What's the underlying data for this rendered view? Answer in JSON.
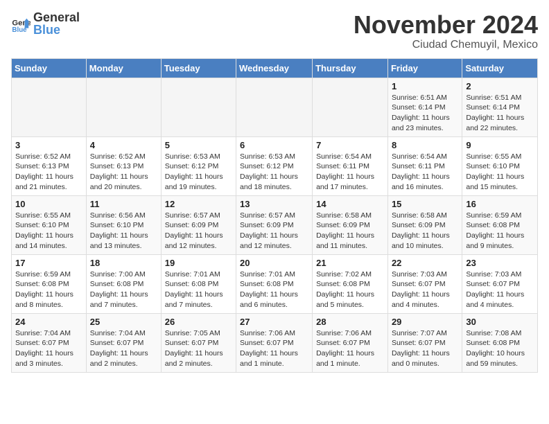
{
  "header": {
    "logo_general": "General",
    "logo_blue": "Blue",
    "month": "November 2024",
    "location": "Ciudad Chemuyil, Mexico"
  },
  "weekdays": [
    "Sunday",
    "Monday",
    "Tuesday",
    "Wednesday",
    "Thursday",
    "Friday",
    "Saturday"
  ],
  "weeks": [
    [
      {
        "day": "",
        "detail": ""
      },
      {
        "day": "",
        "detail": ""
      },
      {
        "day": "",
        "detail": ""
      },
      {
        "day": "",
        "detail": ""
      },
      {
        "day": "",
        "detail": ""
      },
      {
        "day": "1",
        "detail": "Sunrise: 6:51 AM\nSunset: 6:14 PM\nDaylight: 11 hours and 23 minutes."
      },
      {
        "day": "2",
        "detail": "Sunrise: 6:51 AM\nSunset: 6:14 PM\nDaylight: 11 hours and 22 minutes."
      }
    ],
    [
      {
        "day": "3",
        "detail": "Sunrise: 6:52 AM\nSunset: 6:13 PM\nDaylight: 11 hours and 21 minutes."
      },
      {
        "day": "4",
        "detail": "Sunrise: 6:52 AM\nSunset: 6:13 PM\nDaylight: 11 hours and 20 minutes."
      },
      {
        "day": "5",
        "detail": "Sunrise: 6:53 AM\nSunset: 6:12 PM\nDaylight: 11 hours and 19 minutes."
      },
      {
        "day": "6",
        "detail": "Sunrise: 6:53 AM\nSunset: 6:12 PM\nDaylight: 11 hours and 18 minutes."
      },
      {
        "day": "7",
        "detail": "Sunrise: 6:54 AM\nSunset: 6:11 PM\nDaylight: 11 hours and 17 minutes."
      },
      {
        "day": "8",
        "detail": "Sunrise: 6:54 AM\nSunset: 6:11 PM\nDaylight: 11 hours and 16 minutes."
      },
      {
        "day": "9",
        "detail": "Sunrise: 6:55 AM\nSunset: 6:10 PM\nDaylight: 11 hours and 15 minutes."
      }
    ],
    [
      {
        "day": "10",
        "detail": "Sunrise: 6:55 AM\nSunset: 6:10 PM\nDaylight: 11 hours and 14 minutes."
      },
      {
        "day": "11",
        "detail": "Sunrise: 6:56 AM\nSunset: 6:10 PM\nDaylight: 11 hours and 13 minutes."
      },
      {
        "day": "12",
        "detail": "Sunrise: 6:57 AM\nSunset: 6:09 PM\nDaylight: 11 hours and 12 minutes."
      },
      {
        "day": "13",
        "detail": "Sunrise: 6:57 AM\nSunset: 6:09 PM\nDaylight: 11 hours and 12 minutes."
      },
      {
        "day": "14",
        "detail": "Sunrise: 6:58 AM\nSunset: 6:09 PM\nDaylight: 11 hours and 11 minutes."
      },
      {
        "day": "15",
        "detail": "Sunrise: 6:58 AM\nSunset: 6:09 PM\nDaylight: 11 hours and 10 minutes."
      },
      {
        "day": "16",
        "detail": "Sunrise: 6:59 AM\nSunset: 6:08 PM\nDaylight: 11 hours and 9 minutes."
      }
    ],
    [
      {
        "day": "17",
        "detail": "Sunrise: 6:59 AM\nSunset: 6:08 PM\nDaylight: 11 hours and 8 minutes."
      },
      {
        "day": "18",
        "detail": "Sunrise: 7:00 AM\nSunset: 6:08 PM\nDaylight: 11 hours and 7 minutes."
      },
      {
        "day": "19",
        "detail": "Sunrise: 7:01 AM\nSunset: 6:08 PM\nDaylight: 11 hours and 7 minutes."
      },
      {
        "day": "20",
        "detail": "Sunrise: 7:01 AM\nSunset: 6:08 PM\nDaylight: 11 hours and 6 minutes."
      },
      {
        "day": "21",
        "detail": "Sunrise: 7:02 AM\nSunset: 6:08 PM\nDaylight: 11 hours and 5 minutes."
      },
      {
        "day": "22",
        "detail": "Sunrise: 7:03 AM\nSunset: 6:07 PM\nDaylight: 11 hours and 4 minutes."
      },
      {
        "day": "23",
        "detail": "Sunrise: 7:03 AM\nSunset: 6:07 PM\nDaylight: 11 hours and 4 minutes."
      }
    ],
    [
      {
        "day": "24",
        "detail": "Sunrise: 7:04 AM\nSunset: 6:07 PM\nDaylight: 11 hours and 3 minutes."
      },
      {
        "day": "25",
        "detail": "Sunrise: 7:04 AM\nSunset: 6:07 PM\nDaylight: 11 hours and 2 minutes."
      },
      {
        "day": "26",
        "detail": "Sunrise: 7:05 AM\nSunset: 6:07 PM\nDaylight: 11 hours and 2 minutes."
      },
      {
        "day": "27",
        "detail": "Sunrise: 7:06 AM\nSunset: 6:07 PM\nDaylight: 11 hours and 1 minute."
      },
      {
        "day": "28",
        "detail": "Sunrise: 7:06 AM\nSunset: 6:07 PM\nDaylight: 11 hours and 1 minute."
      },
      {
        "day": "29",
        "detail": "Sunrise: 7:07 AM\nSunset: 6:07 PM\nDaylight: 11 hours and 0 minutes."
      },
      {
        "day": "30",
        "detail": "Sunrise: 7:08 AM\nSunset: 6:08 PM\nDaylight: 10 hours and 59 minutes."
      }
    ]
  ]
}
